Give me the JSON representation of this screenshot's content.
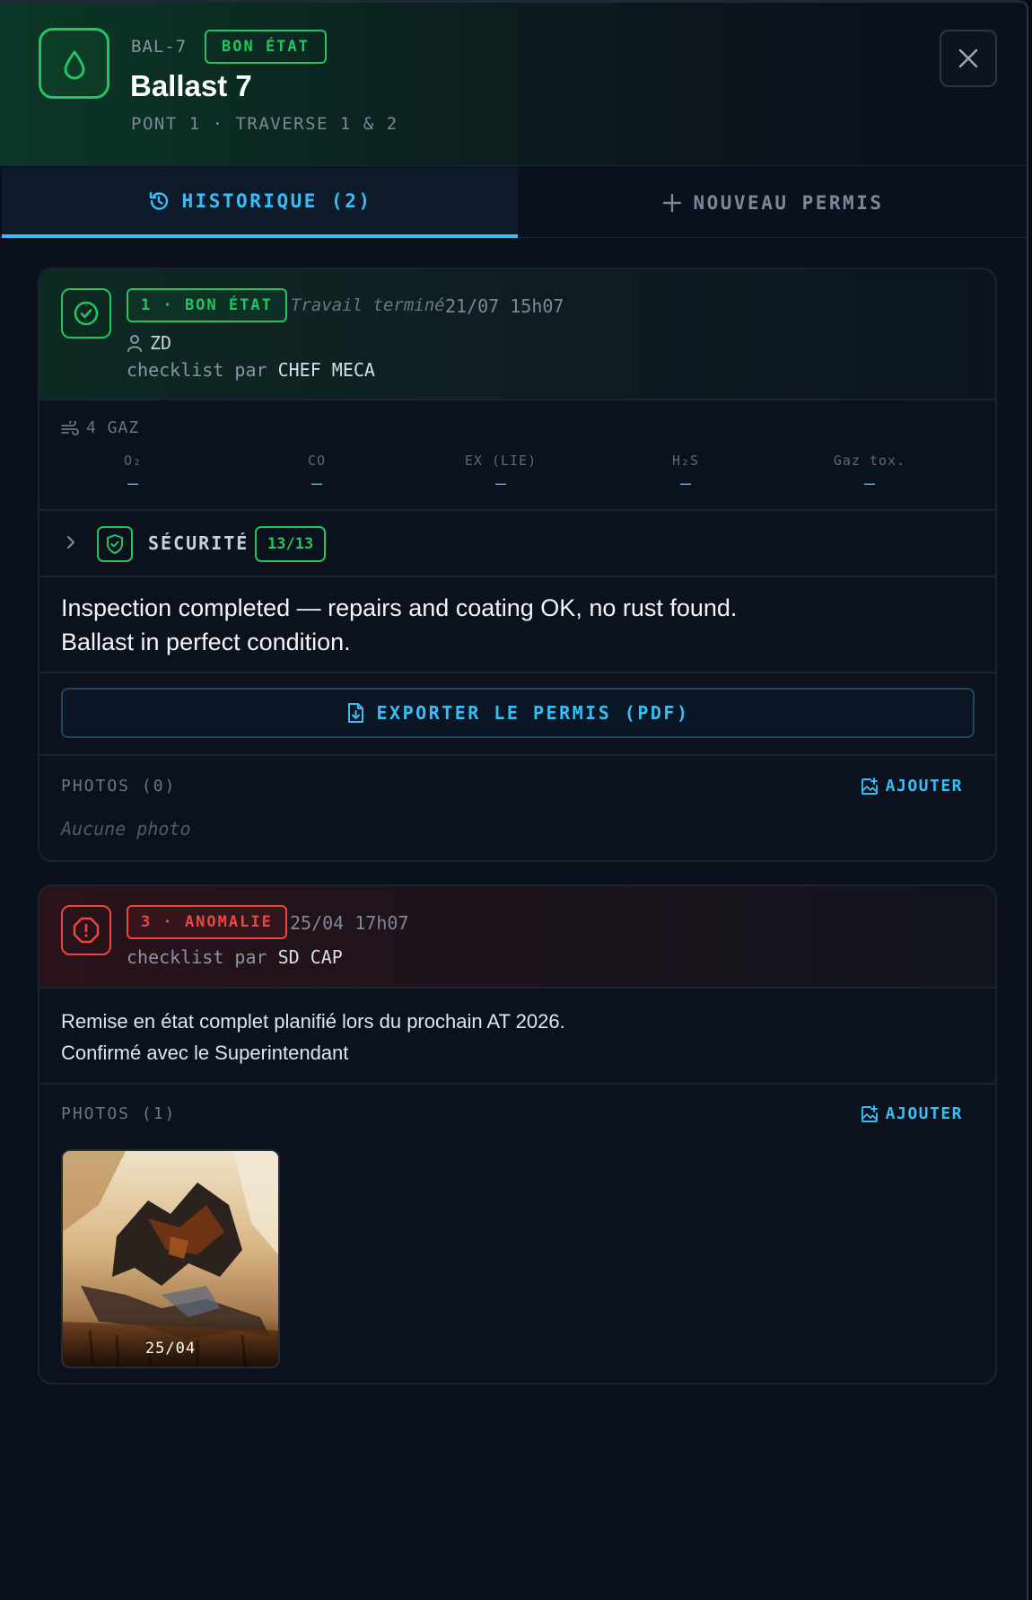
{
  "header": {
    "code": "BAL-7",
    "status_badge": "BON ÉTAT",
    "title": "Ballast 7",
    "location": "PONT 1 · TRAVERSE 1 & 2",
    "icon": "droplet-icon",
    "accent_color": "#22c55e"
  },
  "tabs": {
    "history_label": "HISTORIQUE (2)",
    "new_label": "NOUVEAU PERMIS",
    "active": "history"
  },
  "entries": [
    {
      "status_badge": "1 · BON ÉTAT",
      "status_color": "#22c55e",
      "completed_label": "Travail terminé",
      "date": "21/07 15h07",
      "user": "ZD",
      "checklist_prefix": "checklist par",
      "checklist_by": "CHEF MECA",
      "gas": {
        "title": "4 GAZ",
        "columns": [
          {
            "label": "O₂",
            "value": "–"
          },
          {
            "label": "CO",
            "value": "–"
          },
          {
            "label": "EX (LIE)",
            "value": "–"
          },
          {
            "label": "H₂S",
            "value": "–"
          },
          {
            "label": "Gaz tox.",
            "value": "–"
          }
        ]
      },
      "security": {
        "label": "SÉCURITÉ",
        "count": "13/13"
      },
      "note_line1": "Inspection completed — repairs and coating OK, no rust found.",
      "note_line2": "Ballast in perfect condition.",
      "export_label": "EXPORTER LE PERMIS (PDF)",
      "photos_title": "PHOTOS (0)",
      "add_label": "AJOUTER",
      "no_photo": "Aucune photo"
    },
    {
      "status_badge": "3 · ANOMALIE",
      "status_color": "#ef4444",
      "date": "25/04 17h07",
      "checklist_prefix": "checklist par",
      "checklist_by": "SD CAP",
      "note_line1": "Remise en état complet planifié lors du prochain AT 2026.",
      "note_line2": "Confirmé avec le Superintendant",
      "photos_title": "PHOTOS (1)",
      "add_label": "AJOUTER",
      "photos": [
        {
          "caption": "25/04"
        }
      ]
    }
  ]
}
